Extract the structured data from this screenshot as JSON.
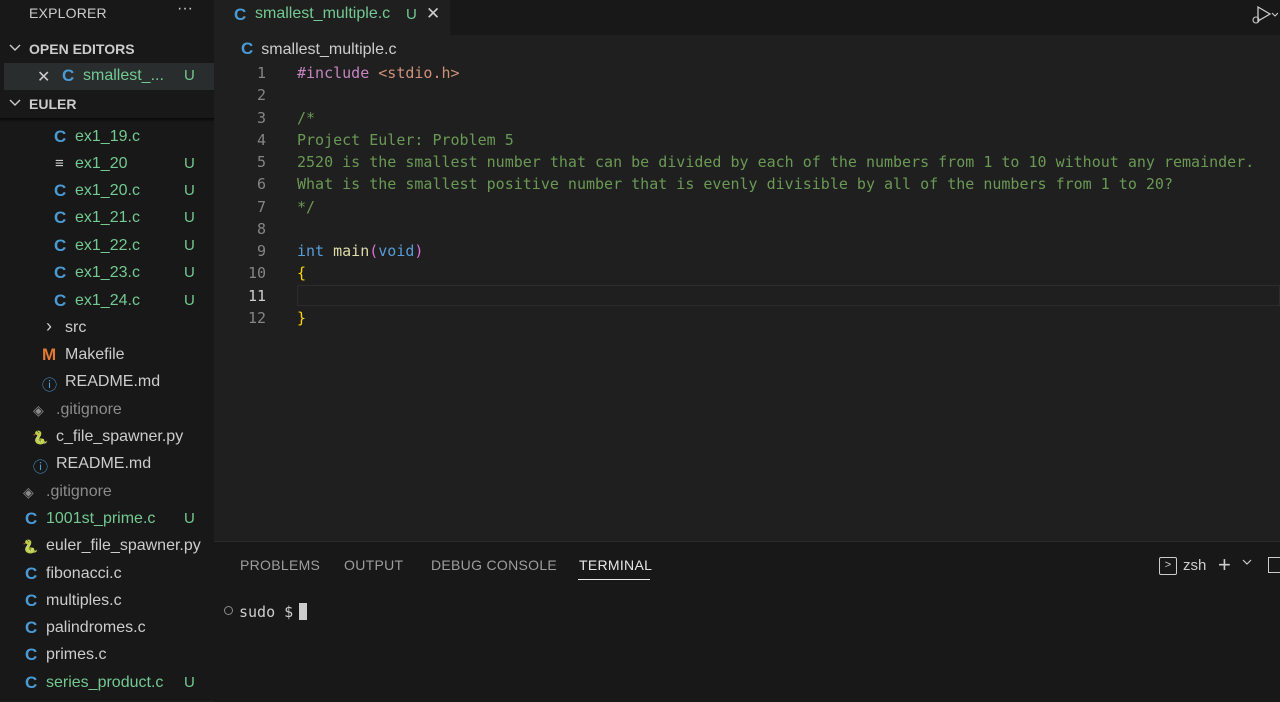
{
  "explorer": {
    "title": "EXPLORER",
    "more": "···",
    "open_editors_label": "OPEN EDITORS",
    "open_editor": {
      "icon": "C",
      "name": "smallest_...",
      "status": "U"
    },
    "folder_label": "EULER",
    "files": [
      {
        "icon": "C",
        "name": "ex1_19.c",
        "status": ""
      },
      {
        "icon": "≡",
        "name": "ex1_20",
        "status": "U"
      },
      {
        "icon": "C",
        "name": "ex1_20.c",
        "status": "U"
      },
      {
        "icon": "C",
        "name": "ex1_21.c",
        "status": "U"
      },
      {
        "icon": "C",
        "name": "ex1_22.c",
        "status": "U"
      },
      {
        "icon": "C",
        "name": "ex1_23.c",
        "status": "U"
      },
      {
        "icon": "C",
        "name": "ex1_24.c",
        "status": "U"
      },
      {
        "icon": "›",
        "name": "src",
        "status": ""
      },
      {
        "icon": "M",
        "name": "Makefile",
        "status": ""
      },
      {
        "icon": "ⓘ",
        "name": "README.md",
        "status": ""
      },
      {
        "icon": "◈",
        "name": ".gitignore",
        "status": ""
      },
      {
        "icon": "🐍",
        "name": "c_file_spawner.py",
        "status": ""
      },
      {
        "icon": "ⓘ",
        "name": "README.md",
        "status": ""
      },
      {
        "icon": "◈",
        "name": ".gitignore",
        "status": ""
      },
      {
        "icon": "C",
        "name": "1001st_prime.c",
        "status": "U"
      },
      {
        "icon": "🐍",
        "name": "euler_file_spawner.py",
        "status": ""
      },
      {
        "icon": "C",
        "name": "fibonacci.c",
        "status": ""
      },
      {
        "icon": "C",
        "name": "multiples.c",
        "status": ""
      },
      {
        "icon": "C",
        "name": "palindromes.c",
        "status": ""
      },
      {
        "icon": "C",
        "name": "primes.c",
        "status": ""
      },
      {
        "icon": "C",
        "name": "series_product.c",
        "status": "U"
      }
    ]
  },
  "tab": {
    "icon": "C",
    "name": "smallest_multiple.c",
    "status": "U",
    "close": "✕"
  },
  "breadcrumb": {
    "icon": "C",
    "name": "smallest_multiple.c"
  },
  "editor": {
    "line_numbers": [
      "1",
      "2",
      "3",
      "4",
      "5",
      "6",
      "7",
      "8",
      "9",
      "10",
      "11",
      "12"
    ],
    "lines": {
      "l1_pre": "#include",
      "l1_str": " <stdio.h>",
      "l3": "/*",
      "l4": "Project Euler: Problem 5",
      "l5": "2520 is the smallest number that can be divided by each of the numbers from 1 to 10 without any remainder.",
      "l6": "What is the smallest positive number that is evenly divisible by all of the numbers from 1 to 20?",
      "l7": "*/",
      "l9_kw": "int",
      "l9_fn": "main",
      "l9_open": "(",
      "l9_void": "void",
      "l9_close": ")",
      "l10": "{",
      "l12": "}"
    }
  },
  "panel": {
    "tabs": [
      "PROBLEMS",
      "OUTPUT",
      "DEBUG CONSOLE",
      "TERMINAL"
    ],
    "shell": "zsh",
    "shell_icon": ">",
    "add": "+",
    "prompt": "sudo $"
  }
}
